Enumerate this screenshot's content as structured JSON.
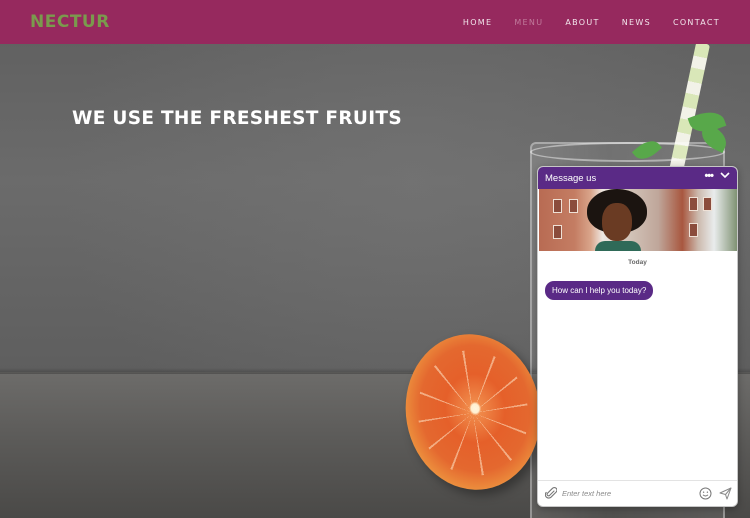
{
  "brand": {
    "logo_text": "NECTUR",
    "logo_color": "#7a9a4d",
    "nav_color": "#96295e"
  },
  "nav": {
    "items": [
      {
        "label": "HOME",
        "active": false
      },
      {
        "label": "MENU",
        "active": true
      },
      {
        "label": "ABOUT",
        "active": false
      },
      {
        "label": "NEWS",
        "active": false
      },
      {
        "label": "CONTACT",
        "active": false
      }
    ]
  },
  "hero": {
    "headline": "WE USE THE FRESHEST FRUITS"
  },
  "chat": {
    "title": "Message us",
    "accent_color": "#5a2a86",
    "menu_icon": "more-horizontal-icon",
    "collapse_icon": "chevron-down-icon",
    "date_label": "Today",
    "messages": [
      {
        "from": "agent",
        "text": "How can I help you today?"
      }
    ],
    "input_placeholder": "Enter text here",
    "icons": {
      "attach": "paperclip-icon",
      "emoji": "emoji-icon",
      "send": "send-icon"
    }
  }
}
